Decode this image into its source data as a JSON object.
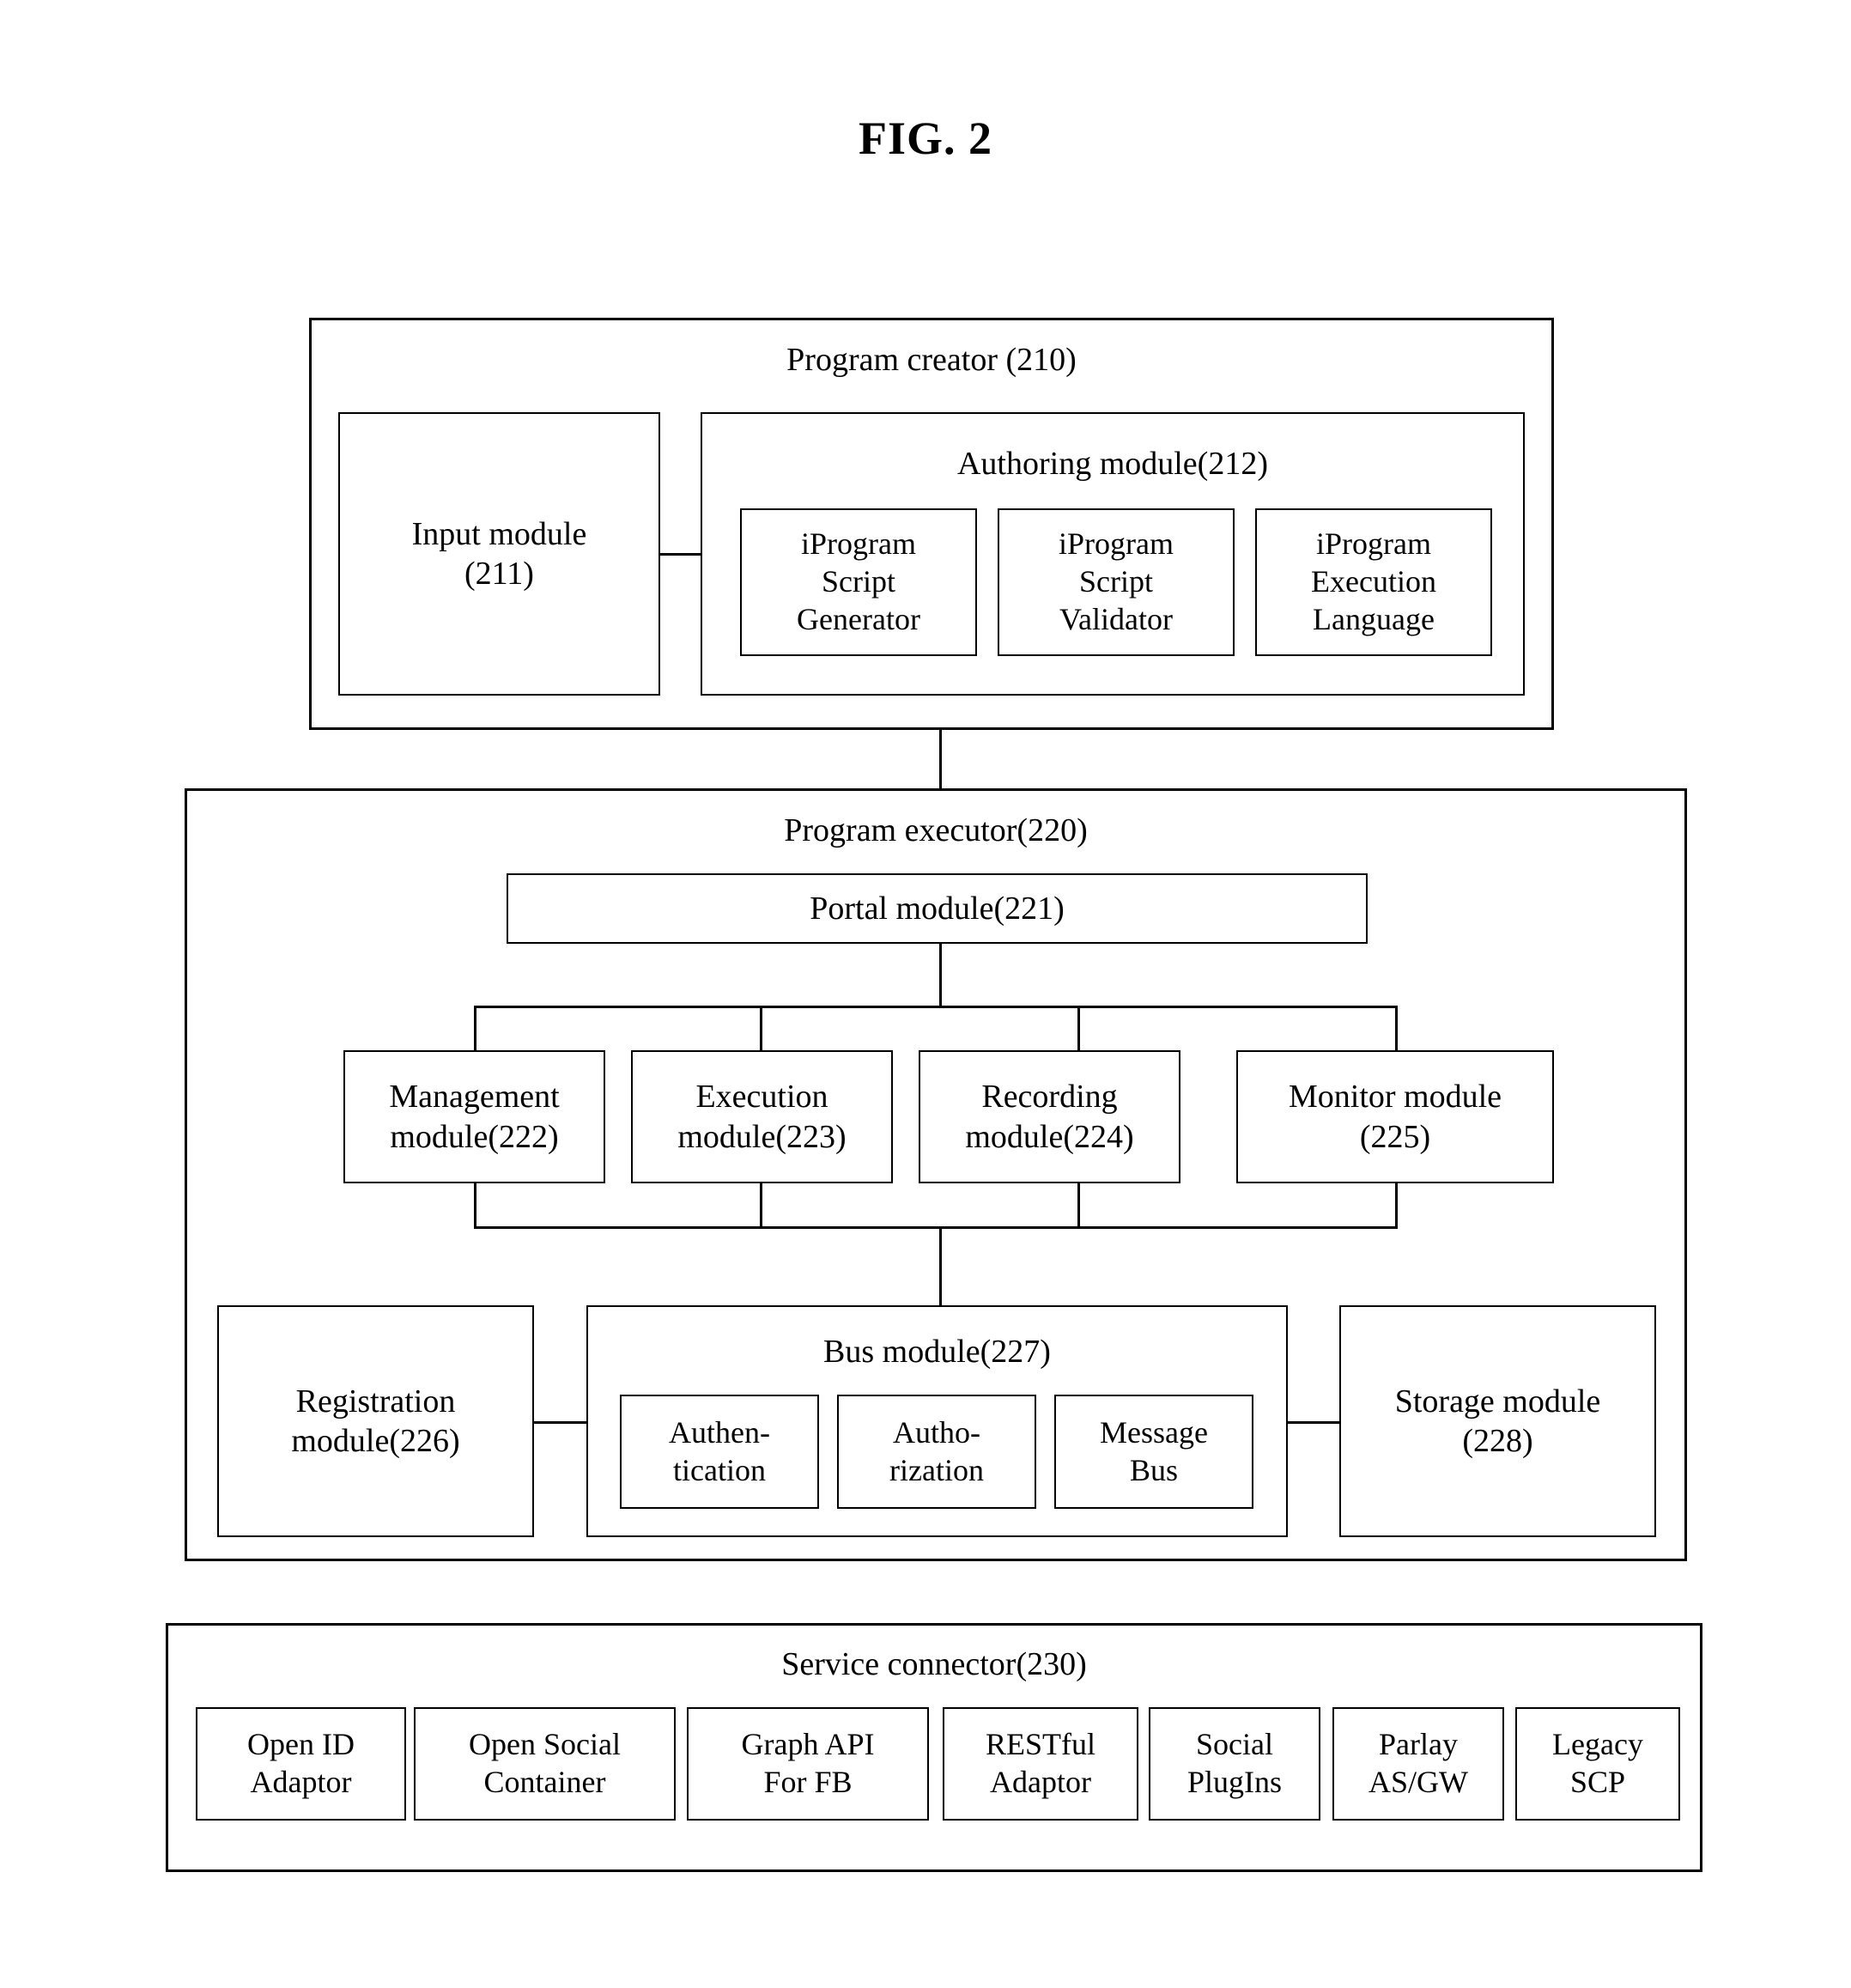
{
  "figure": {
    "title": "FIG. 2"
  },
  "program_creator": {
    "title": "Program creator (210)",
    "input_module": {
      "line1": "Input module",
      "line2": "(211)"
    },
    "authoring_module": {
      "title": "Authoring module(212)",
      "items": [
        {
          "line1": "iProgram",
          "line2": "Script",
          "line3": "Generator"
        },
        {
          "line1": "iProgram",
          "line2": "Script",
          "line3": "Validator"
        },
        {
          "line1": "iProgram",
          "line2": "Execution",
          "line3": "Language"
        }
      ]
    }
  },
  "program_executor": {
    "title": "Program executor(220)",
    "portal_module": "Portal module(221)",
    "modules": [
      {
        "line1": "Management",
        "line2": "module(222)"
      },
      {
        "line1": "Execution",
        "line2": "module(223)"
      },
      {
        "line1": "Recording",
        "line2": "module(224)"
      },
      {
        "line1": "Monitor module",
        "line2": "(225)"
      }
    ],
    "registration_module": {
      "line1": "Registration",
      "line2": "module(226)"
    },
    "bus_module": {
      "title": "Bus module(227)",
      "items": [
        {
          "line1": "Authen-",
          "line2": "tication"
        },
        {
          "line1": "Autho-",
          "line2": "rization"
        },
        {
          "line1": "Message",
          "line2": "Bus"
        }
      ]
    },
    "storage_module": {
      "line1": "Storage module",
      "line2": "(228)"
    }
  },
  "service_connector": {
    "title": "Service connector(230)",
    "items": [
      {
        "line1": "Open ID",
        "line2": "Adaptor"
      },
      {
        "line1": "Open Social",
        "line2": "Container"
      },
      {
        "line1": "Graph API",
        "line2": "For FB"
      },
      {
        "line1": "RESTful",
        "line2": "Adaptor"
      },
      {
        "line1": "Social",
        "line2": "PlugIns"
      },
      {
        "line1": "Parlay",
        "line2": "AS/GW"
      },
      {
        "line1": "Legacy",
        "line2": "SCP"
      }
    ]
  }
}
